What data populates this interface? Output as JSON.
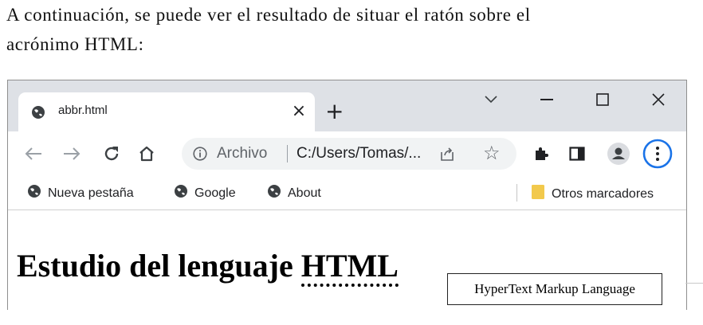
{
  "intro": {
    "line1": "A continuación, se puede ver el resultado de situar el ratón sobre el",
    "line2": "acrónimo HTML:"
  },
  "browser": {
    "tab": {
      "title": "abbr.html",
      "favicon": "globe-icon",
      "close_glyph": "×"
    },
    "new_tab_glyph": "+",
    "address": {
      "scheme_label": "Archivo",
      "url": "C:/Users/Tomas/..."
    },
    "bookmarks": [
      {
        "label": "Nueva pestaña",
        "icon": "globe-icon"
      },
      {
        "label": "Google",
        "icon": "globe-icon"
      },
      {
        "label": "About",
        "icon": "globe-icon"
      }
    ],
    "other_bookmarks": {
      "label": "Otros marcadores",
      "icon": "folder-icon"
    },
    "colors": {
      "tabstrip": "#dee1e6",
      "folder": "#f2c94c",
      "menu_ring": "#1a73e8"
    }
  },
  "page": {
    "heading_prefix": "Estudio del lenguaje ",
    "abbr": "HTML",
    "tooltip": "HyperText Markup Language"
  }
}
